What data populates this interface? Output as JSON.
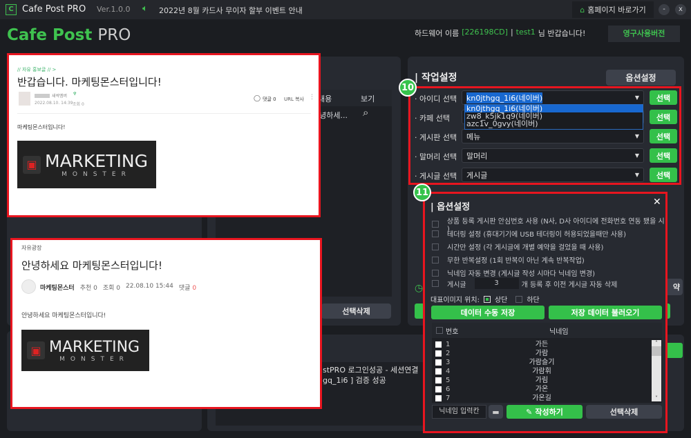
{
  "titlebar": {
    "app_name": "Cafe Post PRO",
    "version": "Ver.1.0.0",
    "notice": "2022년 8월 카드사 무이자 할부 이벤트 안내",
    "homepage": "홈페이지 바로가기",
    "minimize": "-",
    "close": "x"
  },
  "header": {
    "logo_a": "Cafe Post",
    "logo_b": "PRO",
    "hw_label": "하드웨어 이름",
    "hw_id": "[226198CD]",
    "sep": "|",
    "user": "test1",
    "greeting": "님 반갑습니다!",
    "license": "영구사용버전"
  },
  "middle": {
    "col_content": "내용",
    "col_view": "보기",
    "row_content": "안녕하세...",
    "delete": "선택삭제"
  },
  "log": {
    "lines": [
      "stPRO 로그인성공 - 세션연결",
      "gq_1i6 ] 검증 성공"
    ]
  },
  "work": {
    "title": "작업설정",
    "options_btn": "옵션설정",
    "badge": "10",
    "rows": [
      {
        "label": "· 아이디 선택",
        "value": "kn0jthgq_1i6(네이버)"
      },
      {
        "label": "· 카페 선택",
        "value": ""
      },
      {
        "label": "· 게시판 선택",
        "value": "메뉴"
      },
      {
        "label": "· 말머리 선택",
        "value": "말머리"
      },
      {
        "label": "· 게시글 선택",
        "value": "게시글"
      }
    ],
    "select_btn": "선택",
    "dropdown": [
      "kn0jthgq_1i6(네이버)",
      "zw8_k5jk1q9(네이버)",
      "azc1v_0gvy(네이버)"
    ]
  },
  "bg_partial": {
    "reserve": "약"
  },
  "options": {
    "badge": "11",
    "title": "옵션설정",
    "close": "✕",
    "checks": [
      "상품 등록 게시판 안심번호 사용 (N사, D사 아이디에 전화번호 연동 됐을 시 )",
      "테더링 설정 (휴대기기에 USB 테더링이 허용되었을때만 사용)",
      "시간만 설정 (각 게시글에 개별 예약을 걸었을 때 사용)",
      "무한 반복설정 (1회 반복이 아닌 계속 반복작업)",
      "닉네임 자동 변경 (게시글 작성 시마다 닉네임 변경)"
    ],
    "post_label": "게시글",
    "post_count": "3",
    "post_suffix": "개 등록 후 이전 게시글 자동 삭제",
    "img_pos_label": "대표이미지 위치:",
    "img_top": "상단",
    "img_bottom": "하단",
    "img_top_checked": true,
    "save": "데이터 수동 저장",
    "load": "저장 데이터 불러오기",
    "col_no": "번호",
    "col_nick": "닉네임",
    "nicknames": [
      {
        "no": "1",
        "nick": "가든"
      },
      {
        "no": "2",
        "nick": "가람"
      },
      {
        "no": "3",
        "nick": "가람슬기"
      },
      {
        "no": "4",
        "nick": "가람휘"
      },
      {
        "no": "5",
        "nick": "가림"
      },
      {
        "no": "6",
        "nick": "가온"
      },
      {
        "no": "7",
        "nick": "가온길"
      }
    ],
    "nick_placeholder": "닉네임 입력칸",
    "write": "작성하기",
    "delete": "선택삭제"
  },
  "post1": {
    "board": "// 자유 홍보글 // >",
    "title": "반갑습니다. 마케팅몬스터입니다!",
    "rank": "새싹멤버",
    "date": "2022.08.10. 14:39",
    "views": "조회 0",
    "comments": "댓글 0",
    "url_copy": "URL 복사",
    "body": "마케팅몬스터입니다!",
    "logo_text": "MARKETING MONSTER"
  },
  "post2": {
    "board": "자유광장",
    "title": "안녕하세요 마케팅몬스터입니다!",
    "author": "마케팅몬스터",
    "likes": "추천 0",
    "views": "조회 0",
    "date": "22.08.10 15:44",
    "comments_label": "댓글",
    "comments_count": "0",
    "body": "안녕하세요 마케팅몬스터입니다!",
    "logo_text": "MARKETING MONSTER"
  },
  "colors": {
    "accent": "#34c04a",
    "highlight": "#e8151f",
    "bg": "#1b1d21"
  }
}
